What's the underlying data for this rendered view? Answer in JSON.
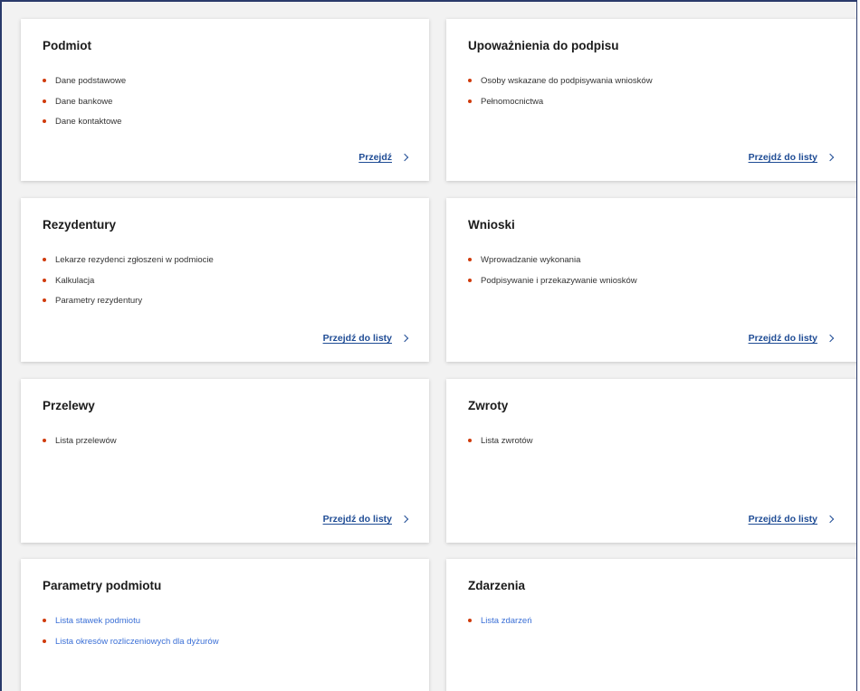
{
  "cards": [
    {
      "title": "Podmiot",
      "items": [
        "Dane podstawowe",
        "Dane bankowe",
        "Dane kontaktowe"
      ],
      "action": "Przejdź"
    },
    {
      "title": "Upoważnienia do podpisu",
      "items": [
        "Osoby wskazane do podpisywania wniosków",
        "Pełnomocnictwa"
      ],
      "action": "Przejdź do listy"
    },
    {
      "title": "Rezydentury",
      "items": [
        "Lekarze rezydenci zgłoszeni w podmiocie",
        "Kalkulacja",
        "Parametry rezydentury"
      ],
      "action": "Przejdź do listy"
    },
    {
      "title": "Wnioski",
      "items": [
        "Wprowadzanie wykonania",
        "Podpisywanie i przekazywanie wniosków"
      ],
      "action": "Przejdź do listy"
    },
    {
      "title": "Przelewy",
      "items": [
        "Lista przelewów"
      ],
      "action": "Przejdź do listy"
    },
    {
      "title": "Zwroty",
      "items": [
        "Lista zwrotów"
      ],
      "action": "Przejdź do listy"
    },
    {
      "title": "Parametry podmiotu",
      "items": [
        "Lista stawek podmiotu",
        "Lista okresów rozliczeniowych dla dyżurów"
      ]
    },
    {
      "title": "Zdarzenia",
      "items": [
        "Lista zdarzeń"
      ]
    }
  ],
  "colors": {
    "bullet": "#d03b0c",
    "action_link": "#1f4c95",
    "item_link": "#3a6fd6",
    "frame_border": "#2a3a6b"
  },
  "icons": {
    "action": "chevron-right-icon",
    "bullet": "bullet-dot-icon"
  }
}
